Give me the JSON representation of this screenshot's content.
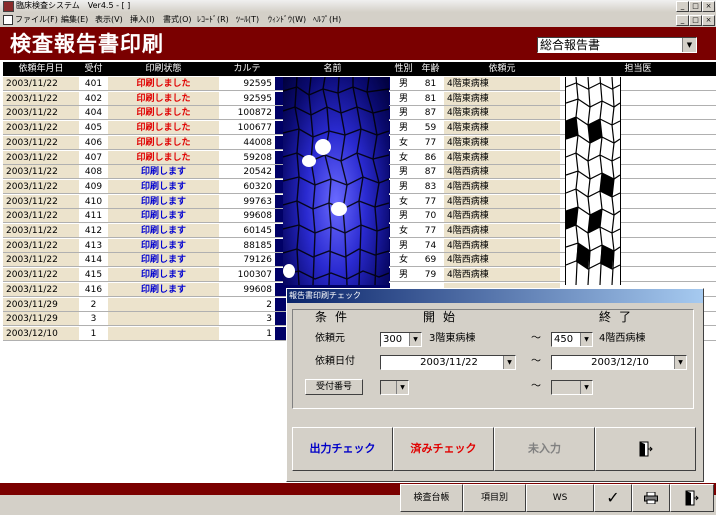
{
  "window": {
    "title": "臨床検査システム　Ver4.5 - [ ]"
  },
  "menu": [
    "ファイル(F)",
    "編集(E)",
    "表示(V)",
    "挿入(I)",
    "書式(O)",
    "ﾚｺｰﾄﾞ(R)",
    "ﾂｰﾙ(T)",
    "ｳｨﾝﾄﾞｳ(W)",
    "ﾍﾙﾌﾟ(H)"
  ],
  "header": {
    "title": "検査報告書印刷",
    "report_type": "総合報告書"
  },
  "columns": [
    "依頼年月日",
    "受付",
    "印刷状態",
    "カルテ",
    "名前",
    "性別",
    "年齢",
    "依頼元",
    "担当医"
  ],
  "rows": [
    {
      "date": "2003/11/22",
      "no": "401",
      "status": "印刷しました",
      "karte": "92595",
      "sex": "男",
      "age": "81",
      "dept": "4階東病棟"
    },
    {
      "date": "2003/11/22",
      "no": "402",
      "status": "印刷しました",
      "karte": "92595",
      "sex": "男",
      "age": "81",
      "dept": "4階東病棟"
    },
    {
      "date": "2003/11/22",
      "no": "404",
      "status": "印刷しました",
      "karte": "100872",
      "sex": "男",
      "age": "87",
      "dept": "4階東病棟"
    },
    {
      "date": "2003/11/22",
      "no": "405",
      "status": "印刷しました",
      "karte": "100677",
      "sex": "男",
      "age": "59",
      "dept": "4階東病棟"
    },
    {
      "date": "2003/11/22",
      "no": "406",
      "status": "印刷しました",
      "karte": "44008",
      "sex": "女",
      "age": "77",
      "dept": "4階東病棟"
    },
    {
      "date": "2003/11/22",
      "no": "407",
      "status": "印刷しました",
      "karte": "59208",
      "sex": "女",
      "age": "86",
      "dept": "4階東病棟"
    },
    {
      "date": "2003/11/22",
      "no": "408",
      "status": "印刷します",
      "karte": "20542",
      "sex": "男",
      "age": "87",
      "dept": "4階西病棟"
    },
    {
      "date": "2003/11/22",
      "no": "409",
      "status": "印刷します",
      "karte": "60320",
      "sex": "男",
      "age": "83",
      "dept": "4階西病棟"
    },
    {
      "date": "2003/11/22",
      "no": "410",
      "status": "印刷します",
      "karte": "99763",
      "sex": "女",
      "age": "77",
      "dept": "4階西病棟"
    },
    {
      "date": "2003/11/22",
      "no": "411",
      "status": "印刷します",
      "karte": "99608",
      "sex": "男",
      "age": "70",
      "dept": "4階西病棟"
    },
    {
      "date": "2003/11/22",
      "no": "412",
      "status": "印刷します",
      "karte": "60145",
      "sex": "女",
      "age": "77",
      "dept": "4階西病棟"
    },
    {
      "date": "2003/11/22",
      "no": "413",
      "status": "印刷します",
      "karte": "88185",
      "sex": "男",
      "age": "74",
      "dept": "4階西病棟"
    },
    {
      "date": "2003/11/22",
      "no": "414",
      "status": "印刷します",
      "karte": "79126",
      "sex": "女",
      "age": "69",
      "dept": "4階西病棟"
    },
    {
      "date": "2003/11/22",
      "no": "415",
      "status": "印刷します",
      "karte": "100307",
      "sex": "男",
      "age": "79",
      "dept": "4階西病棟"
    },
    {
      "date": "2003/11/22",
      "no": "416",
      "status": "印刷します",
      "karte": "99608",
      "sex": "",
      "age": "",
      "dept": ""
    },
    {
      "date": "2003/11/29",
      "no": "2",
      "status": "",
      "karte": "2",
      "sex": "",
      "age": "",
      "dept": ""
    },
    {
      "date": "2003/11/29",
      "no": "3",
      "status": "",
      "karte": "3",
      "sex": "",
      "age": "",
      "dept": ""
    },
    {
      "date": "2003/12/10",
      "no": "1",
      "status": "",
      "karte": "1",
      "sex": "",
      "age": "",
      "dept": ""
    }
  ],
  "dialog": {
    "title": "報告書印刷チェック",
    "col_condition": "条件",
    "col_start": "開始",
    "col_end": "終了",
    "label_source": "依頼元",
    "label_date": "依頼日付",
    "button_receipt": "受付番号",
    "source_from_code": "300",
    "source_from_name": "3階東病棟",
    "source_to_code": "450",
    "source_to_name": "4階西病棟",
    "date_from": "2003/11/22",
    "date_to": "2003/12/10",
    "tilde": "～",
    "btn_output_check": "出力チェック",
    "btn_done_check": "済みチェック",
    "btn_not_entered": "未入力"
  },
  "footer": {
    "btn_ledger": "検査台帳",
    "btn_by_item": "項目別",
    "btn_ws": "WS"
  },
  "colors": {
    "title_bar_red": "#7a0000",
    "printed_red": "#e00000",
    "to_print_blue": "#0000d0"
  }
}
